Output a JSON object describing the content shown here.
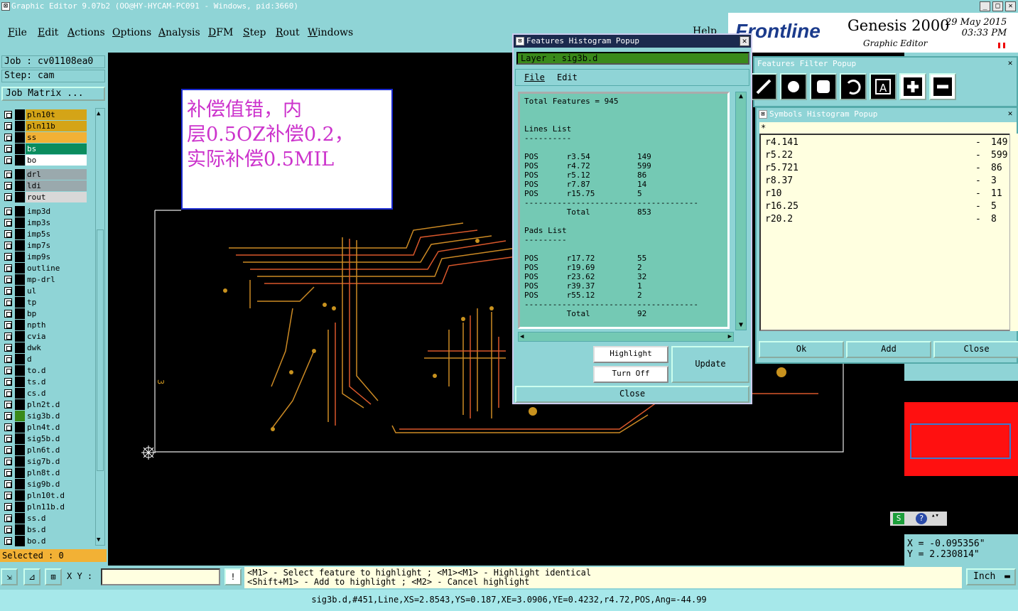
{
  "window": {
    "title": "Graphic Editor 9.07b2 (OO@HY-HYCAM-PC091 - Windows, pid:3660)",
    "help": "Help"
  },
  "menu": [
    "File",
    "Edit",
    "Actions",
    "Options",
    "Analysis",
    "DFM",
    "Step",
    "Rout",
    "Windows"
  ],
  "logo": {
    "brand": "Frontline",
    "product": "Genesis 2000",
    "subtitle": "Graphic Editor",
    "date": "29 May 2015",
    "time": "03:33 PM"
  },
  "job": {
    "job_label": "Job : cv01108ea0",
    "step_label": "Step: cam",
    "job_matrix": "Job Matrix ..."
  },
  "layers": [
    {
      "name": "pln10t",
      "color": "#d4a417"
    },
    {
      "name": "pln11b",
      "color": "#d4a417"
    },
    {
      "name": "ss",
      "color": "#f2b135"
    },
    {
      "name": "bs",
      "color": "#0b8c5e"
    },
    {
      "name": "bo",
      "color": "#ffffff"
    },
    {
      "name": "drl",
      "color": "#9aa9ad"
    },
    {
      "name": "ldi",
      "color": "#9aa9ad"
    },
    {
      "name": "rout",
      "color": "#d8d8d8"
    },
    {
      "name": "imp3d",
      "color": "#8fd4d6"
    },
    {
      "name": "imp3s",
      "color": "#8fd4d6"
    },
    {
      "name": "imp5s",
      "color": "#8fd4d6"
    },
    {
      "name": "imp7s",
      "color": "#8fd4d6"
    },
    {
      "name": "imp9s",
      "color": "#8fd4d6"
    },
    {
      "name": "outline",
      "color": "#8fd4d6"
    },
    {
      "name": "mp-drl",
      "color": "#8fd4d6"
    },
    {
      "name": "ul",
      "color": "#8fd4d6"
    },
    {
      "name": "tp",
      "color": "#8fd4d6"
    },
    {
      "name": "bp",
      "color": "#8fd4d6"
    },
    {
      "name": "npth",
      "color": "#8fd4d6"
    },
    {
      "name": "cvia",
      "color": "#8fd4d6"
    },
    {
      "name": "dwk",
      "color": "#8fd4d6"
    },
    {
      "name": "d",
      "color": "#8fd4d6"
    },
    {
      "name": "to.d",
      "color": "#8fd4d6"
    },
    {
      "name": "ts.d",
      "color": "#8fd4d6"
    },
    {
      "name": "cs.d",
      "color": "#8fd4d6"
    },
    {
      "name": "pln2t.d",
      "color": "#8fd4d6"
    },
    {
      "name": "sig3b.d",
      "color": "#8fd4d6",
      "active": true
    },
    {
      "name": "pln4t.d",
      "color": "#8fd4d6"
    },
    {
      "name": "sig5b.d",
      "color": "#8fd4d6"
    },
    {
      "name": "pln6t.d",
      "color": "#8fd4d6"
    },
    {
      "name": "sig7b.d",
      "color": "#8fd4d6"
    },
    {
      "name": "pln8t.d",
      "color": "#8fd4d6"
    },
    {
      "name": "sig9b.d",
      "color": "#8fd4d6"
    },
    {
      "name": "pln10t.d",
      "color": "#8fd4d6"
    },
    {
      "name": "pln11b.d",
      "color": "#8fd4d6"
    },
    {
      "name": "ss.d",
      "color": "#8fd4d6"
    },
    {
      "name": "bs.d",
      "color": "#8fd4d6"
    },
    {
      "name": "bo.d",
      "color": "#8fd4d6"
    }
  ],
  "selected": "Selected : 0",
  "note": {
    "line1": "补偿值错，内",
    "line2": "层0.5OZ补偿0.2，",
    "line3": "实际补偿0.5MIL"
  },
  "canvas": {
    "marker": "3"
  },
  "features_popup": {
    "title": "Features Histogram Popup",
    "layer": "Layer :  sig3b.d",
    "menu_file": "File",
    "menu_edit": "Edit",
    "content": "Total Features = 945\n\n\nLines List\n----------\n\nPOS      r3.54          149\nPOS      r4.72          599\nPOS      r5.12          86\nPOS      r7.87          14\nPOS      r15.75         5\n-------------------------------------\n         Total          853\n\nPads List\n---------\n\nPOS      r17.72         55\nPOS      r19.69         2\nPOS      r23.62         32\nPOS      r39.37         1\nPOS      r55.12         2\n-------------------------------------\n         Total          92",
    "highlight": "Highlight",
    "turn_off": "Turn Off",
    "update": "Update",
    "close": "Close"
  },
  "filter_popup": {
    "title": "Features Filter Popup"
  },
  "symbols_popup": {
    "title": "Symbols Histogram Popup",
    "filter": "*",
    "items": [
      {
        "sym": "r4.141",
        "dash": "-",
        "count": "149"
      },
      {
        "sym": "r5.22",
        "dash": "-",
        "count": "599"
      },
      {
        "sym": "r5.721",
        "dash": "-",
        "count": "86"
      },
      {
        "sym": "r8.37",
        "dash": "-",
        "count": "3"
      },
      {
        "sym": "r10",
        "dash": "-",
        "count": "11"
      },
      {
        "sym": "r16.25",
        "dash": "-",
        "count": "5"
      },
      {
        "sym": "r20.2",
        "dash": "-",
        "count": "8"
      }
    ],
    "ok": "Ok",
    "add": "Add",
    "close": "Close"
  },
  "coords": {
    "x": "X = -0.095356\"",
    "y": "Y = 2.230814\""
  },
  "bottom": {
    "xy_label": "X Y :",
    "msg1": "<M1> - Select feature to highlight ; <M1><M1> - Highlight identical",
    "msg2": "<Shift+M1> - Add to highlight ; <M2> - Cancel highlight",
    "unit": "Inch"
  },
  "status": "sig3b.d,#451,Line,XS=2.8543,YS=0.187,XE=3.0906,YE=0.4232,r4.72,POS,Ang=-44.99"
}
